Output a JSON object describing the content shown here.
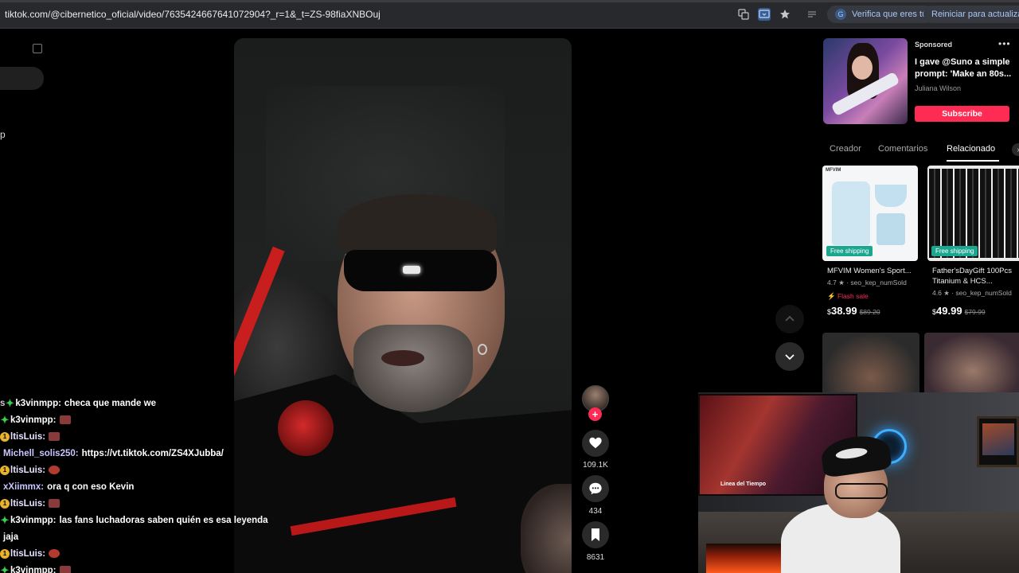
{
  "browser": {
    "url": "tiktok.com/@cibernetico_oficial/video/7635424667641072904?_r=1&_t=ZS-98fiaXNBOuj",
    "verify_label": "Verifica que eres tú",
    "update_label": "Reiniciar para actualizar"
  },
  "sidebar": {
    "partial_text": "p"
  },
  "actions": {
    "likes": "109.1K",
    "comments": "434",
    "saves": "8631"
  },
  "chat": [
    {
      "badge": "green",
      "user": "k3vinmpp:",
      "text": "checa que mande we",
      "prefix": "s",
      "emote": ""
    },
    {
      "badge": "green",
      "user": "k3vinmpp:",
      "text": "",
      "prefix": "",
      "emote": "a"
    },
    {
      "badge": "gold",
      "user": "ltisLuis:",
      "text": "",
      "prefix": "",
      "emote": "a"
    },
    {
      "badge": "",
      "user": "Michell_solis250:",
      "text": "https://vt.tiktok.com/ZS4XJubba/",
      "prefix": "",
      "emote": ""
    },
    {
      "badge": "gold",
      "user": "ltisLuis:",
      "text": "",
      "prefix": "",
      "emote": "b"
    },
    {
      "badge": "",
      "user": "xXiimmx:",
      "text": "ora q con eso Kevin",
      "prefix": "",
      "emote": ""
    },
    {
      "badge": "gold",
      "user": "ltisLuis:",
      "text": "",
      "prefix": "",
      "emote": "a"
    },
    {
      "badge": "green",
      "user": "k3vinmpp:",
      "text": "las fans luchadoras saben quién es esa leyenda",
      "prefix": "",
      "emote": ""
    },
    {
      "badge": "",
      "user": "",
      "text": "jaja",
      "prefix": "",
      "emote": ""
    },
    {
      "badge": "gold",
      "user": "ltisLuis:",
      "text": "",
      "prefix": "",
      "emote": "b"
    },
    {
      "badge": "green",
      "user": "k3vinmpp:",
      "text": "",
      "prefix": "",
      "emote": "a"
    }
  ],
  "ad": {
    "sponsored": "Sponsored",
    "title": "I gave @Suno a simple prompt: 'Make an 80s...",
    "author": "Juliana Wilson",
    "cta": "Subscribe"
  },
  "tabs": [
    {
      "label": "Creador"
    },
    {
      "label": "Comentarios"
    },
    {
      "label": "Relacionado"
    }
  ],
  "products": [
    {
      "name": "MFVIM Women's Sport...",
      "rating": "4.7",
      "sold": "seo_kep_numSold",
      "flash": "Flash sale",
      "currency": "$",
      "price": "38.99",
      "old_price": "$89.20",
      "shipping": "Free shipping",
      "logo": "MFVIM"
    },
    {
      "name": "Father'sDayGift 100Pcs Titanium & HCS...",
      "rating": "4.6",
      "sold": "seo_kep_numSold",
      "flash": "",
      "currency": "$",
      "price": "49.99",
      "old_price": "$79.99",
      "shipping": "Free shipping"
    }
  ],
  "webcam": {
    "tv_caption": "Linea del Tiempo"
  },
  "colors": {
    "accent": "#fe2c55",
    "ship": "#1aa68f",
    "browser_bg": "#28292c"
  }
}
